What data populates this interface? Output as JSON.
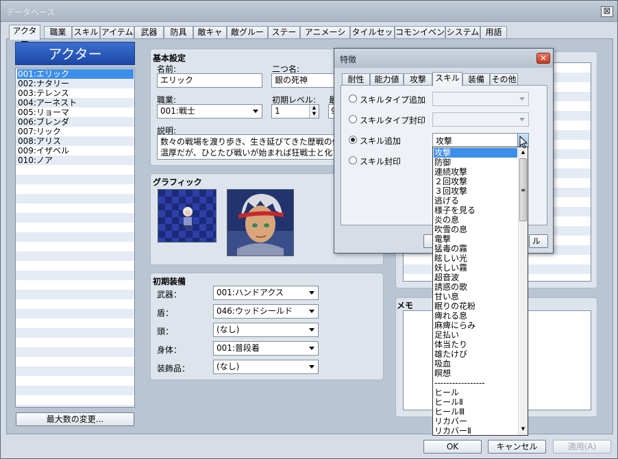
{
  "window": {
    "title": "データベース",
    "close_symbol": "⊠"
  },
  "tabs": [
    "アクター",
    "職業",
    "スキル",
    "アイテム",
    "武器",
    "防具",
    "敵キャラ",
    "敵グループ",
    "ステート",
    "アニメーション",
    "タイルセット",
    "コモンイベント",
    "システム",
    "用語"
  ],
  "actor_list": {
    "header": "アクター",
    "items": [
      "001:エリック",
      "002:ナタリー",
      "003:テレンス",
      "004:アーネスト",
      "005:リョーマ",
      "006:ブレンダ",
      "007:リック",
      "008:アリス",
      "009:イザベル",
      "010:ノア"
    ],
    "selected_index": 0,
    "max_button": "最大数の変更..."
  },
  "basic": {
    "title": "基本設定",
    "name_label": "名前:",
    "name_value": "エリック",
    "nickname_label": "二つ名:",
    "nickname_value": "銀の死神",
    "class_label": "職業:",
    "class_value": "001:戦士",
    "init_level_label": "初期レベル:",
    "init_level_value": "1",
    "max_level_label_partial": "最",
    "max_level_value_partial": "9",
    "desc_label": "説明:",
    "desc_line1": "数々の戦場を渡り歩き、生き延びてきた歴戦の傭",
    "desc_line2": "温厚だが、ひとたび戦いが始まれば狂戦士と化す"
  },
  "graphic": {
    "title": "グラフィック"
  },
  "equip": {
    "title": "初期装備",
    "rows": [
      {
        "label": "武器：",
        "value": "001:ハンドアクス"
      },
      {
        "label": "盾：",
        "value": "046:ウッドシールド"
      },
      {
        "label": "頭：",
        "value": "(なし)"
      },
      {
        "label": "身体：",
        "value": "001:普段着"
      },
      {
        "label": "装飾品：",
        "value": "(なし)"
      }
    ]
  },
  "memo": {
    "title": "メモ"
  },
  "bottom": {
    "ok": "OK",
    "cancel": "キャンセル",
    "apply": "適用(A)"
  },
  "dialog": {
    "title": "特徴",
    "tabs": [
      "耐性",
      "能力値",
      "攻撃",
      "スキル",
      "装備",
      "その他"
    ],
    "active_tab": 3,
    "options": [
      {
        "label": "スキルタイプ追加",
        "checked": false
      },
      {
        "label": "スキルタイプ封印",
        "checked": false
      },
      {
        "label": "スキル追加",
        "checked": true
      },
      {
        "label": "スキル封印",
        "checked": false
      }
    ],
    "skill_combo_value": "攻撃",
    "behind_button_partial": "ル"
  },
  "dropdown": {
    "items": [
      "攻撃",
      "防御",
      "連続攻撃",
      "２回攻撃",
      "３回攻撃",
      "逃げる",
      "様子を見る",
      "炎の息",
      "吹雪の息",
      "電撃",
      "猛毒の霧",
      "眩しい光",
      "妖しい霧",
      "超音波",
      "誘惑の歌",
      "甘い息",
      "眠りの花粉",
      "痺れる息",
      "麻痺にらみ",
      "足払い",
      "体当たり",
      "雄たけび",
      "吸血",
      "瞑想",
      "-----------------",
      "ヒール",
      "ヒールⅡ",
      "ヒールⅢ",
      "リカバー",
      "リカバーⅡ"
    ],
    "selected_index": 0
  },
  "colors": {
    "selection": "#3d8ee8",
    "list_header": "#2557b8",
    "panel_bg": "#b9c5d3"
  }
}
